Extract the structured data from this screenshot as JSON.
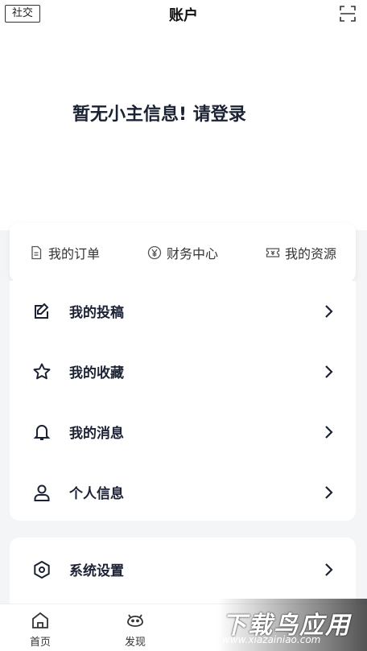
{
  "header": {
    "social_label": "社交",
    "title": "账户",
    "scan_icon": "scan-icon"
  },
  "hero": {
    "login_prompt": "暂无小主信息! 请登录"
  },
  "quick_links": [
    {
      "label": "我的订单",
      "icon": "document-icon"
    },
    {
      "label": "财务中心",
      "icon": "yen-icon"
    },
    {
      "label": "我的资源",
      "icon": "ticket-icon"
    }
  ],
  "menu": [
    {
      "label": "我的投稿",
      "icon": "edit-icon"
    },
    {
      "label": "我的收藏",
      "icon": "star-icon"
    },
    {
      "label": "我的消息",
      "icon": "bell-icon"
    },
    {
      "label": "个人信息",
      "icon": "user-icon"
    }
  ],
  "settings": {
    "label": "系统设置",
    "icon": "settings-icon"
  },
  "tabbar": [
    {
      "label": "首页",
      "icon": "home-icon"
    },
    {
      "label": "发现",
      "icon": "discover-icon"
    }
  ],
  "watermark": {
    "title": "下载鸟应用",
    "url": "www.xiazainiao.com"
  },
  "colors": {
    "text": "#1b2233",
    "background": "#f4f5f7",
    "card": "#ffffff"
  }
}
